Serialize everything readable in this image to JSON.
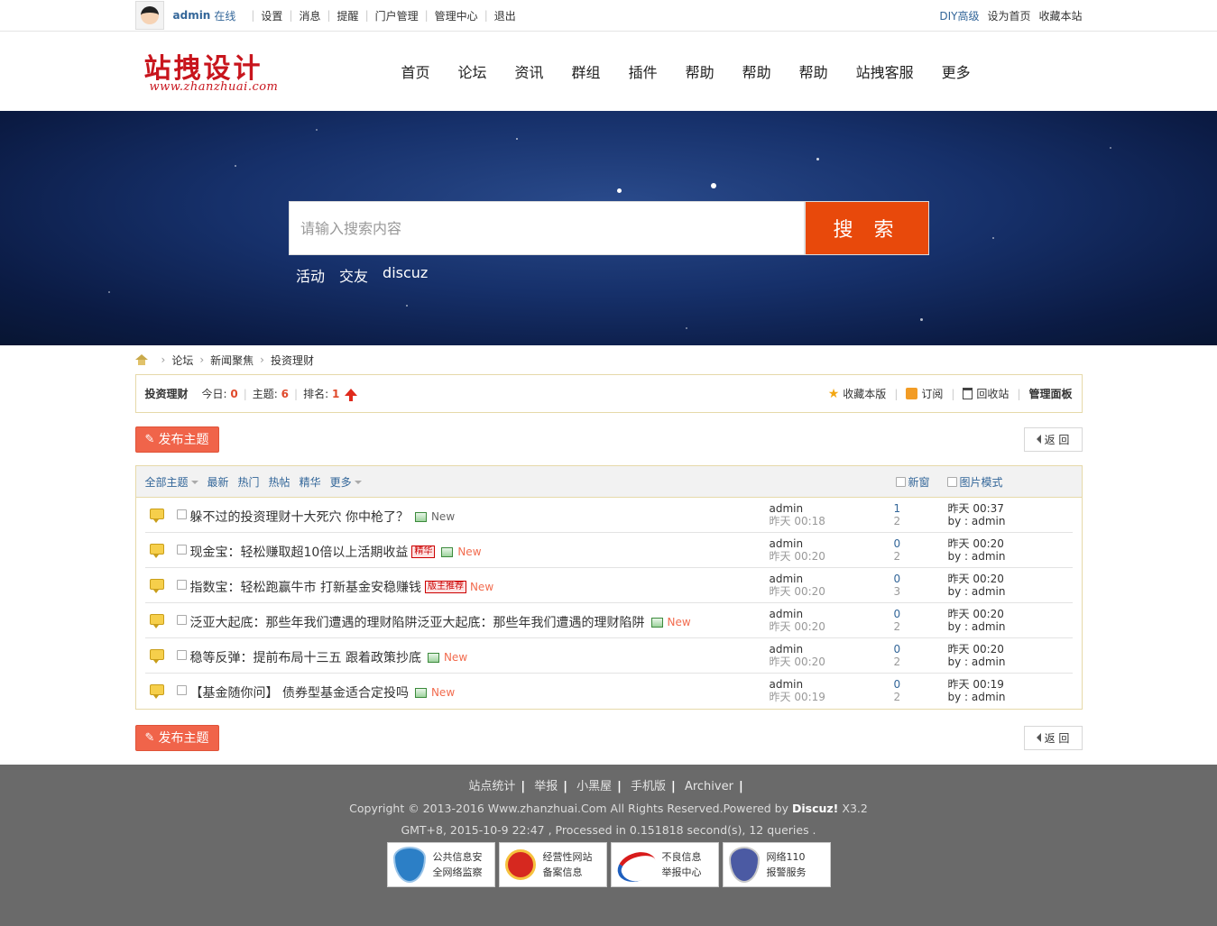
{
  "topbar": {
    "username": "admin",
    "status": "在线",
    "links": [
      "设置",
      "消息",
      "提醒",
      "门户管理",
      "管理中心",
      "退出"
    ],
    "right": {
      "diy": "DIY高级",
      "homepage": "设为首页",
      "favorite": "收藏本站"
    }
  },
  "logo": {
    "cn": "站拽设计",
    "en": "www.zhanzhuai.com"
  },
  "nav": [
    "首页",
    "论坛",
    "资讯",
    "群组",
    "插件",
    "帮助",
    "帮助",
    "帮助",
    "站拽客服",
    "更多"
  ],
  "search": {
    "placeholder": "请输入搜索内容",
    "button": "搜 索",
    "hot": [
      "活动",
      "交友",
      "discuz"
    ]
  },
  "breadcrumb": [
    "论坛",
    "新闻聚焦",
    "投资理财"
  ],
  "forum": {
    "name": "投资理财",
    "today_label": "今日:",
    "today": "0",
    "topics_label": "主题:",
    "topics": "6",
    "rank_label": "排名:",
    "rank": "1",
    "actions": {
      "favorite": "收藏本版",
      "subscribe": "订阅",
      "recycle": "回收站",
      "admin": "管理面板"
    }
  },
  "buttons": {
    "post": "发布主题",
    "back": "返 回"
  },
  "filter": {
    "all": "全部主题",
    "items": [
      "最新",
      "热门",
      "热帖",
      "精华"
    ],
    "more": "更多",
    "new_window": "新窗",
    "image_mode": "图片模式"
  },
  "threads": [
    {
      "title": "躲不过的投资理财十大死穴 你中枪了？",
      "badge": "",
      "new": "New",
      "new_style": "gray",
      "author": "admin",
      "time": "昨天 00:18",
      "replies": "1",
      "views": "2",
      "last_time": "昨天 00:37",
      "last_by": "by : admin"
    },
    {
      "title": "现金宝：轻松赚取超10倍以上活期收益",
      "badge": "精华",
      "new": "New",
      "new_style": "orange",
      "author": "admin",
      "time": "昨天 00:20",
      "replies": "0",
      "views": "2",
      "last_time": "昨天 00:20",
      "last_by": "by : admin"
    },
    {
      "title": "指数宝：轻松跑赢牛市 打新基金安稳赚钱",
      "badge": "版主推荐",
      "new": "New",
      "new_style": "orange",
      "author": "admin",
      "time": "昨天 00:20",
      "replies": "0",
      "views": "3",
      "last_time": "昨天 00:20",
      "last_by": "by : admin"
    },
    {
      "title": "泛亚大起底：那些年我们遭遇的理财陷阱泛亚大起底：那些年我们遭遇的理财陷阱",
      "badge": "",
      "new": "New",
      "new_style": "orange",
      "author": "admin",
      "time": "昨天 00:20",
      "replies": "0",
      "views": "2",
      "last_time": "昨天 00:20",
      "last_by": "by : admin"
    },
    {
      "title": "稳等反弹：提前布局十三五 跟着政策抄底",
      "badge": "",
      "new": "New",
      "new_style": "orange",
      "author": "admin",
      "time": "昨天 00:20",
      "replies": "0",
      "views": "2",
      "last_time": "昨天 00:20",
      "last_by": "by : admin"
    },
    {
      "title": "【基金随你问】 债券型基金适合定投吗",
      "badge": "",
      "new": "New",
      "new_style": "orange",
      "author": "admin",
      "time": "昨天 00:19",
      "replies": "0",
      "views": "2",
      "last_time": "昨天 00:19",
      "last_by": "by : admin"
    }
  ],
  "footer": {
    "links": [
      "站点统计",
      "举报",
      "小黑屋",
      "手机版",
      "Archiver"
    ],
    "copyright": "Copyright  © 2013-2016 Www.zhanzhuai.Com All Rights Reserved.Powered by",
    "powered": "Discuz!",
    "version": "X3.2",
    "processed": "GMT+8, 2015-10-9 22:47 , Processed in 0.151818 second(s), 12 queries .",
    "badges": [
      {
        "line1": "公共信息安",
        "line2": "全网络监察"
      },
      {
        "line1": "经营性网站",
        "line2": "备案信息"
      },
      {
        "line1": "不良信息",
        "line2": "举报中心"
      },
      {
        "line1": "网络110",
        "line2": "报警服务"
      }
    ]
  }
}
